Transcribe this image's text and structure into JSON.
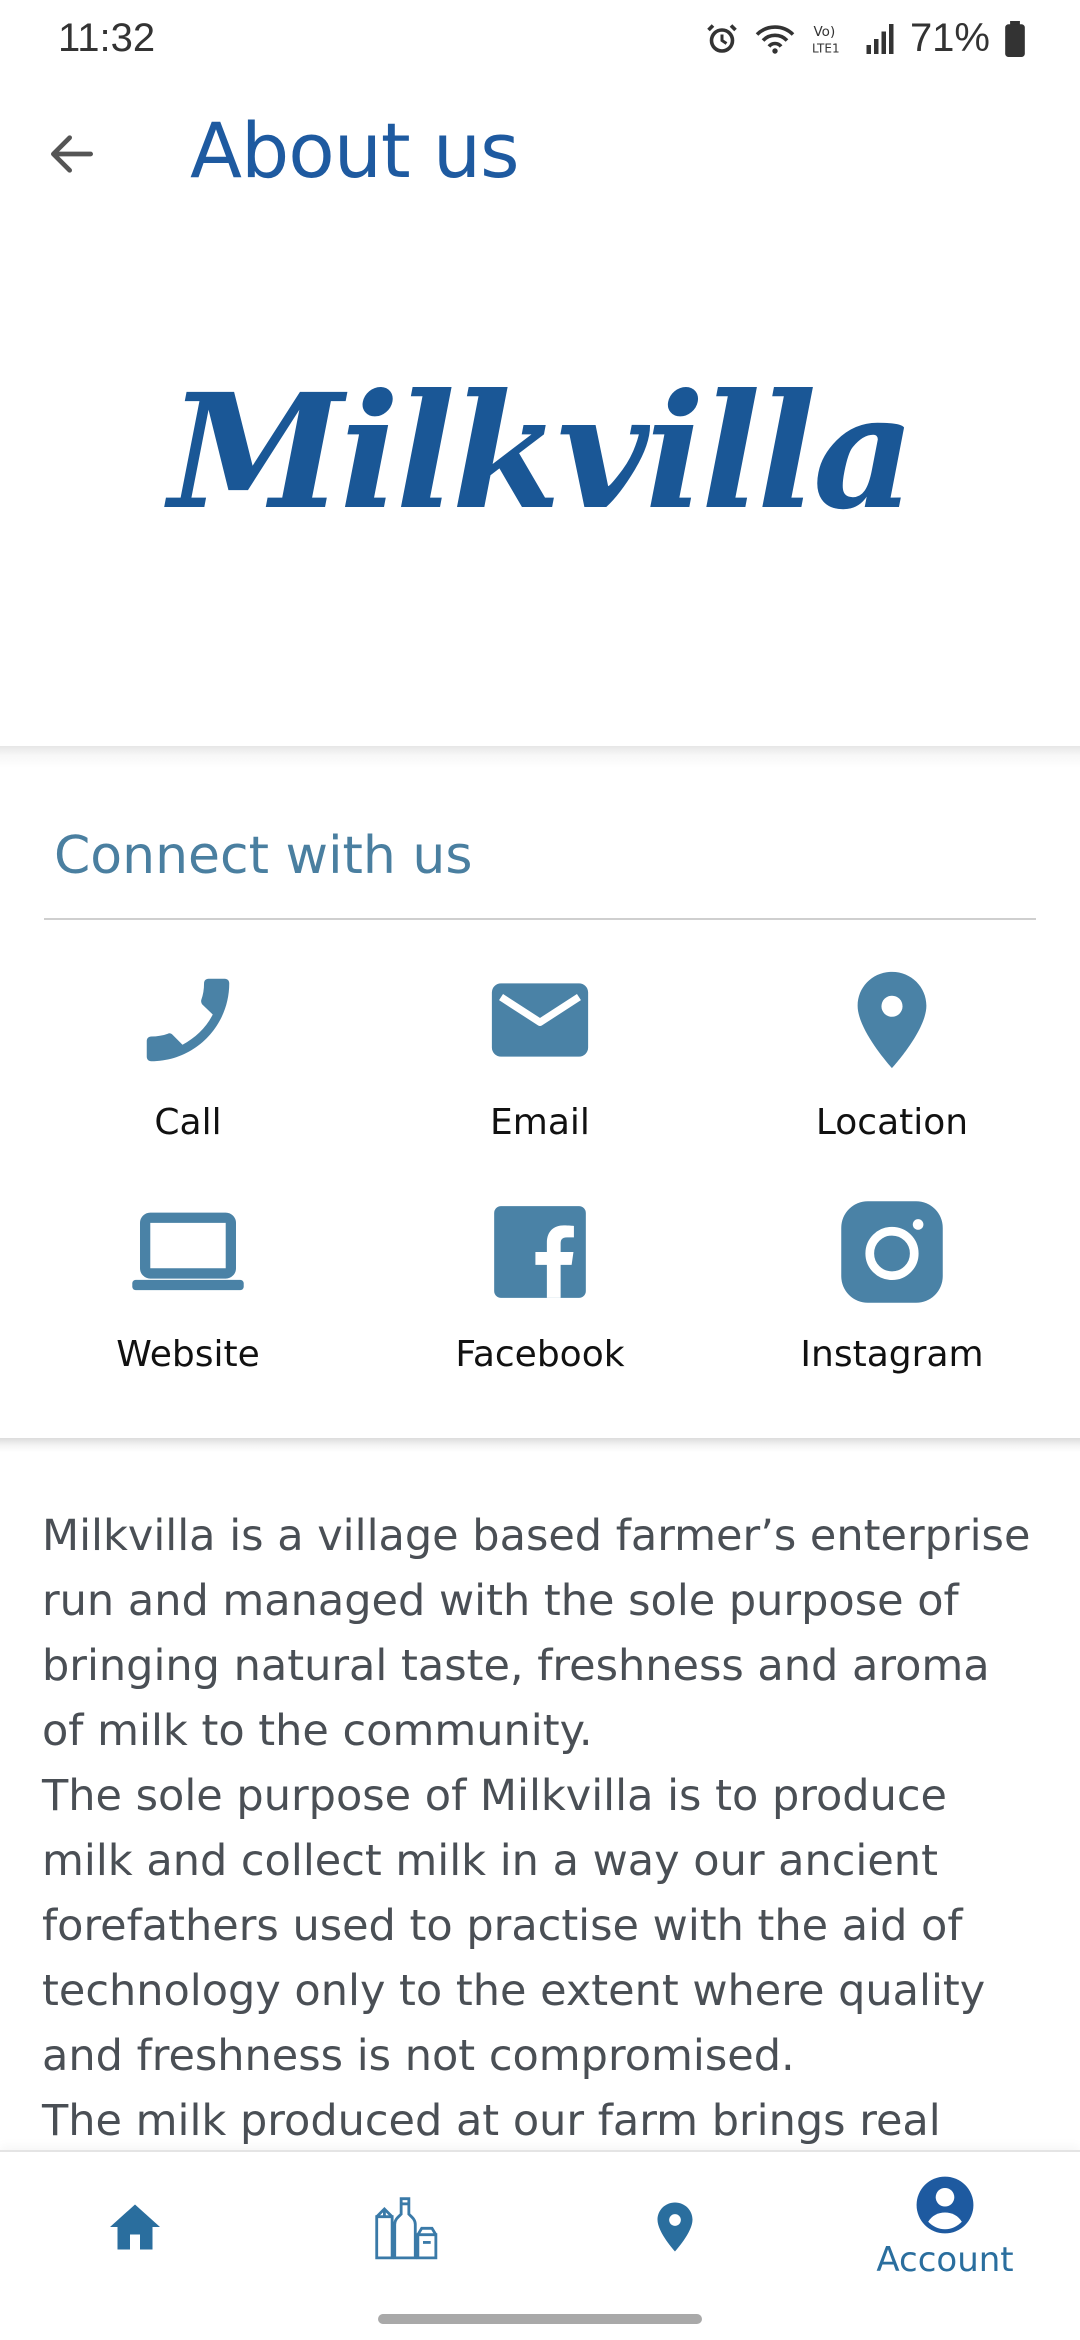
{
  "status_bar": {
    "time": "11:32",
    "battery": "71%",
    "icons": [
      "alarm-icon",
      "wifi-icon",
      "volte-icon",
      "signal-icon",
      "battery-icon"
    ]
  },
  "app_bar": {
    "title": "About us",
    "back_icon": "arrow-left-icon"
  },
  "logo": {
    "text": "Milkvilla"
  },
  "connect": {
    "title": "Connect with us",
    "items": [
      {
        "label": "Call",
        "icon": "phone-icon"
      },
      {
        "label": "Email",
        "icon": "mail-icon"
      },
      {
        "label": "Location",
        "icon": "map-pin-icon"
      },
      {
        "label": "Website",
        "icon": "laptop-icon"
      },
      {
        "label": "Facebook",
        "icon": "facebook-icon"
      },
      {
        "label": "Instagram",
        "icon": "instagram-icon"
      }
    ]
  },
  "about": {
    "paragraphs": [
      "Milkvilla is a village based farmer’s enterprise run and managed with the sole purpose of bringing natural taste, freshness and aroma of milk to the community.",
      "The sole purpose of Milkvilla is to produce milk and collect milk in a way our ancient forefathers used to practise with the aid of technology only to the extent where quality and freshness is not compromised.",
      "The milk produced at our farm brings real"
    ]
  },
  "bottom_nav": {
    "items": [
      {
        "label": "",
        "icon": "home-icon"
      },
      {
        "label": "",
        "icon": "products-icon"
      },
      {
        "label": "",
        "icon": "map-pin-icon"
      },
      {
        "label": "Account",
        "icon": "account-circle-icon"
      }
    ],
    "active_index": 3
  },
  "colors": {
    "title_blue": "#1e5aa0",
    "accent": "#4a7fa0",
    "icon_blue": "#4a82a6",
    "text_gray": "#4a4f55"
  }
}
